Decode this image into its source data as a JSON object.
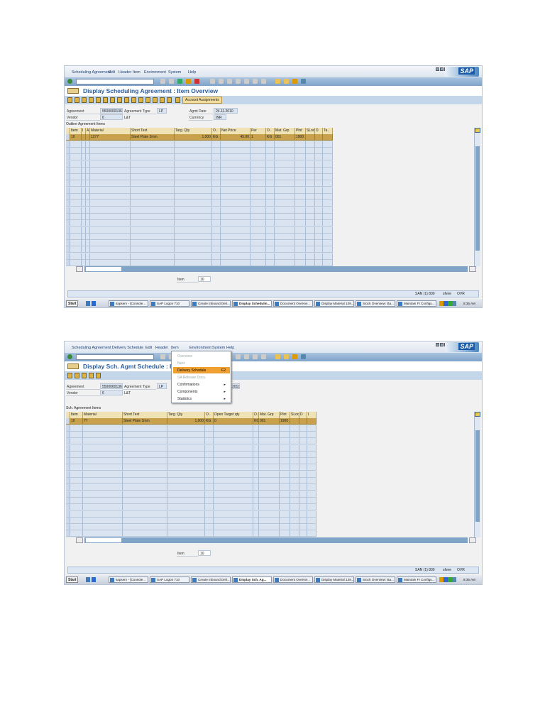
{
  "screens": [
    {
      "menu": [
        "Scheduling Agreement",
        "Edit",
        "Header",
        "Item",
        "Environment",
        "System",
        "Help"
      ],
      "title": "Display Scheduling Agreement : Item Overview",
      "app_icon_count": 15,
      "app_button": "Account Assignments",
      "fields": {
        "agreement_label": "Agreement",
        "agreement": "5500000136",
        "type_label": "Agreement Type",
        "type": "LP",
        "date_label": "Agmt Date",
        "date": "24.11.2010",
        "vendor_label": "Vendor",
        "vendor": "6",
        "vendor_name": "L&T",
        "currency_label": "Currency",
        "currency": "INR"
      },
      "table_title": "Outline Agreement Items",
      "columns": [
        "Item",
        "I",
        "A",
        "Material",
        "Short Text",
        "Targ. Qty",
        "O..",
        "Net Price",
        "Per",
        "O..",
        "Mat. Grp",
        "Plnt",
        "SLoc",
        "D",
        "Ta.."
      ],
      "row": [
        "10",
        "",
        "",
        "1277",
        "Steel Plate 3mm",
        "1,000",
        "KG",
        "45.00",
        "1",
        "KG",
        "001",
        "1900",
        "",
        "",
        ""
      ],
      "item_label": "Item",
      "item_value": "10",
      "status": {
        "system": "SAN (1) 800",
        "server": "sfvee",
        "mode": "OVR"
      },
      "taskbar": {
        "start": "Start",
        "tasks": [
          "sapserv - [Console...",
          "SAP Logon 710",
          "Create Inbound Deli...",
          "Display Schedulin...",
          "Document Overvie...",
          "Display Material 139...",
          "Stock Overview: Ba...",
          "Maintain FI Configu..."
        ],
        "active": 3,
        "time": "8:35 AM"
      }
    },
    {
      "menu": [
        "Scheduling Agreement Delivery Schedule",
        "Edit",
        "Header",
        "Item",
        "Environment",
        "System",
        "Help"
      ],
      "title": "Display Sch. Agmt Schedule : Ite",
      "app_icon_count": 5,
      "fields": {
        "agreement_label": "Agreement",
        "agreement": "5500000136",
        "type_label": "Agreement Type",
        "type": "LP",
        "date_label": "",
        "date": "2010",
        "vendor_label": "Vendor",
        "vendor": "6",
        "vendor_name": "L&T"
      },
      "table_title": "Sch. Agreement Items",
      "columns": [
        "Item",
        "Material",
        "Short Text",
        "Targ. Qty",
        "O..",
        "Open Target qty",
        "O..",
        "Mat. Grp",
        "Plnt",
        "SLoc",
        "D",
        "I"
      ],
      "row": [
        "10",
        "77",
        "Steel Plate 3mm",
        "1,000",
        "KG",
        "0",
        "KG",
        "001",
        "1900",
        "",
        "",
        ""
      ],
      "item_label": "Item",
      "item_value": "10",
      "dropdown": [
        {
          "label": "Overview",
          "state": "disabled"
        },
        {
          "label": "Next",
          "state": "disabled"
        },
        {
          "label": "Delivery Schedule",
          "shortcut": "F2",
          "state": "highlighted"
        },
        {
          "label": "SA Release Docs.",
          "state": "disabled"
        },
        {
          "label": "Confirmations",
          "submenu": "▸"
        },
        {
          "label": "Components",
          "submenu": "▸"
        },
        {
          "label": "Statistics",
          "submenu": "▸"
        }
      ],
      "status": {
        "system": "SAN (1) 800",
        "server": "sfvee",
        "mode": "OVR"
      },
      "taskbar": {
        "start": "Start",
        "tasks": [
          "sapserv - [Console...",
          "SAP Logon 710",
          "Create Inbound Deli...",
          "Display Sch. Ag...",
          "Document Overvie...",
          "Display Material 139...",
          "Stock Overview: Ba...",
          "Maintain FI Configu..."
        ],
        "active": 3,
        "time": "8:35 AM"
      }
    }
  ],
  "logo": "SAP"
}
